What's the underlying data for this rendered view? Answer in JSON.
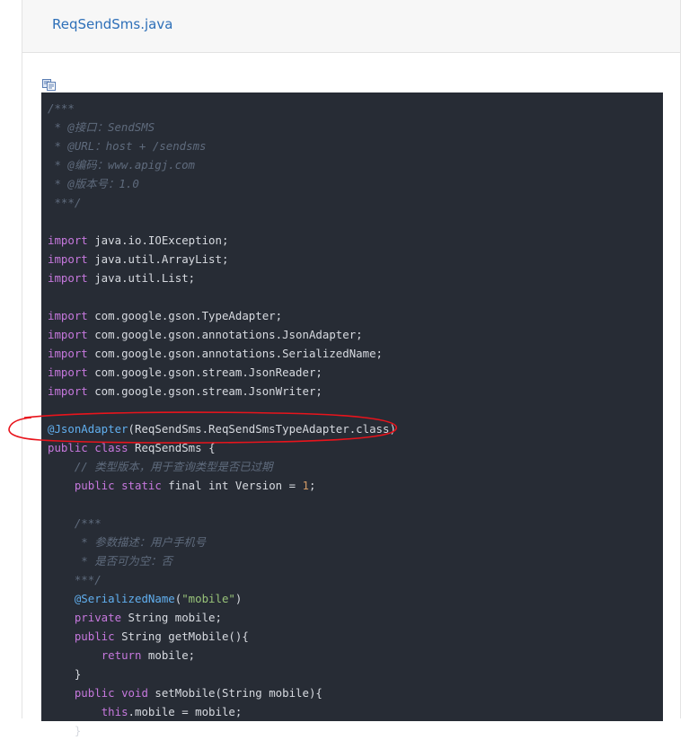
{
  "header": {
    "file_name": "ReqSendSms.java"
  },
  "toolbar": {
    "copy_icon": "copy-icon"
  },
  "code": {
    "lines": [
      [
        [
          "cmt",
          "/***"
        ]
      ],
      [
        [
          "cmt",
          " * @接口：SendSMS"
        ]
      ],
      [
        [
          "cmt",
          " * @URL：host + /sendsms"
        ]
      ],
      [
        [
          "cmt",
          " * @编码：www.apigj.com"
        ]
      ],
      [
        [
          "cmt",
          " * @版本号：1.0"
        ]
      ],
      [
        [
          "cmt",
          " ***/"
        ]
      ],
      [],
      [
        [
          "kw",
          "import"
        ],
        [
          "plain",
          " java.io.IOException;"
        ]
      ],
      [
        [
          "kw",
          "import"
        ],
        [
          "plain",
          " java.util.ArrayList;"
        ]
      ],
      [
        [
          "kw",
          "import"
        ],
        [
          "plain",
          " java.util.List;"
        ]
      ],
      [],
      [
        [
          "kw",
          "import"
        ],
        [
          "plain",
          " com.google.gson.TypeAdapter;"
        ]
      ],
      [
        [
          "kw",
          "import"
        ],
        [
          "plain",
          " com.google.gson.annotations.JsonAdapter;"
        ]
      ],
      [
        [
          "kw",
          "import"
        ],
        [
          "plain",
          " com.google.gson.annotations.SerializedName;"
        ]
      ],
      [
        [
          "kw",
          "import"
        ],
        [
          "plain",
          " com.google.gson.stream.JsonReader;"
        ]
      ],
      [
        [
          "kw",
          "import"
        ],
        [
          "plain",
          " com.google.gson.stream.JsonWriter;"
        ]
      ],
      [],
      [
        [
          "anno",
          "@JsonAdapter"
        ],
        [
          "plain",
          "(ReqSendSms.ReqSendSmsTypeAdapter.class)"
        ]
      ],
      [
        [
          "kw",
          "public"
        ],
        [
          "plain",
          " "
        ],
        [
          "kw",
          "class"
        ],
        [
          "plain",
          " ReqSendSms {"
        ]
      ],
      [
        [
          "cmt",
          "    // 类型版本，用于查询类型是否已过期"
        ]
      ],
      [
        [
          "plain",
          "    "
        ],
        [
          "kw",
          "public"
        ],
        [
          "plain",
          " "
        ],
        [
          "kw",
          "static"
        ],
        [
          "plain",
          " final int Version = "
        ],
        [
          "num",
          "1"
        ],
        [
          "plain",
          ";"
        ]
      ],
      [],
      [
        [
          "cmt",
          "    /***"
        ]
      ],
      [
        [
          "cmt",
          "     * 参数描述：用户手机号"
        ]
      ],
      [
        [
          "cmt",
          "     * 是否可为空：否"
        ]
      ],
      [
        [
          "cmt",
          "    ***/"
        ]
      ],
      [
        [
          "plain",
          "    "
        ],
        [
          "anno",
          "@SerializedName"
        ],
        [
          "plain",
          "("
        ],
        [
          "str",
          "\"mobile\""
        ],
        [
          "plain",
          ")"
        ]
      ],
      [
        [
          "plain",
          "    "
        ],
        [
          "kw",
          "private"
        ],
        [
          "plain",
          " String mobile;"
        ]
      ],
      [
        [
          "plain",
          "    "
        ],
        [
          "kw",
          "public"
        ],
        [
          "plain",
          " String getMobile(){"
        ]
      ],
      [
        [
          "plain",
          "        "
        ],
        [
          "kw",
          "return"
        ],
        [
          "plain",
          " mobile;"
        ]
      ],
      [
        [
          "plain",
          "    }"
        ]
      ],
      [
        [
          "plain",
          "    "
        ],
        [
          "kw",
          "public"
        ],
        [
          "plain",
          " "
        ],
        [
          "kw",
          "void"
        ],
        [
          "plain",
          " setMobile(String mobile){"
        ]
      ],
      [
        [
          "plain",
          "        "
        ],
        [
          "kw",
          "this"
        ],
        [
          "plain",
          ".mobile = mobile;"
        ]
      ],
      [
        [
          "plain",
          "    }"
        ]
      ]
    ]
  },
  "colors": {
    "code_background": "#272c35",
    "keyword": "#c678dd",
    "annotation": "#61afef",
    "comment": "#5f6b7d",
    "string": "#98c379",
    "number": "#d19a66",
    "link": "#2d6fb8",
    "highlight_oval": "#e8141c"
  }
}
